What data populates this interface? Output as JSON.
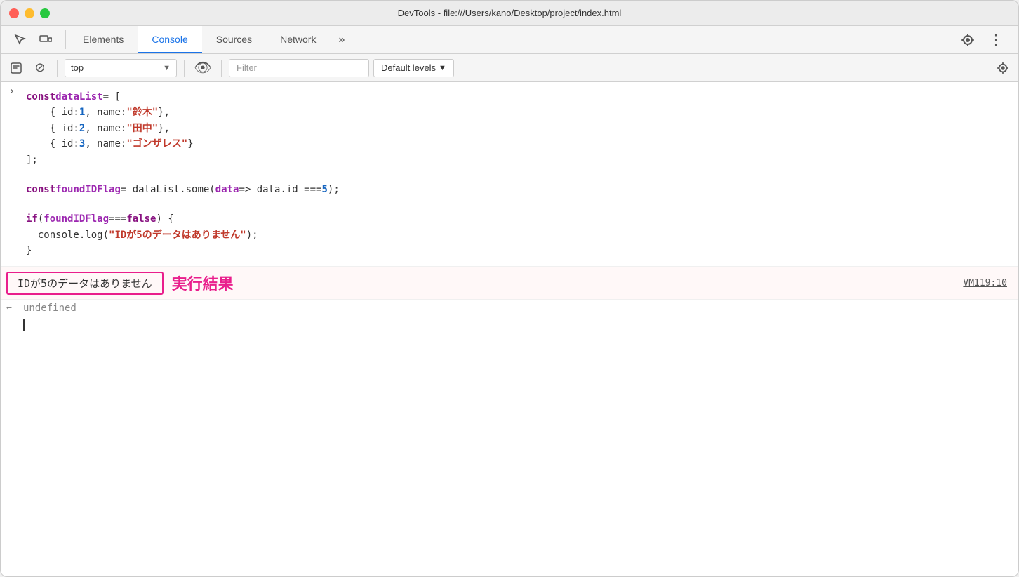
{
  "window": {
    "title": "DevTools - file:///Users/kano/Desktop/project/index.html"
  },
  "tabs": {
    "items": [
      {
        "id": "elements",
        "label": "Elements",
        "active": false
      },
      {
        "id": "console",
        "label": "Console",
        "active": true
      },
      {
        "id": "sources",
        "label": "Sources",
        "active": false
      },
      {
        "id": "network",
        "label": "Network",
        "active": false
      }
    ],
    "more_label": "»"
  },
  "toolbar": {
    "context_value": "top",
    "filter_placeholder": "Filter",
    "default_levels_label": "Default levels",
    "default_levels_arrow": "▼"
  },
  "code": {
    "line1": "const dataList = [",
    "line2_1": "{ id: ",
    "line2_num": "1",
    "line2_2": ", name: ",
    "line2_str": "\"鈴木\"",
    "line2_3": " },",
    "line3_1": "{ id: ",
    "line3_num": "2",
    "line3_2": ", name: ",
    "line3_str": "\"田中\"",
    "line3_3": " },",
    "line4_1": "{ id: ",
    "line4_num": "3",
    "line4_2": ", name: ",
    "line4_str": "\"ゴンザレス\"",
    "line4_3": " }",
    "line5": "];",
    "line6_1": "const foundIDFlag = dataList.some(data => data.id === ",
    "line6_num": "5",
    "line6_2": ");",
    "line7_1": "if (foundIDFlag === false) {",
    "line8": "  console.log(",
    "line8_str": "\"IDが5のデータはありません\"",
    "line8_end": ");",
    "line9": "}"
  },
  "output": {
    "box_text": "IDが5のデータはありません",
    "label_text": "実行結果",
    "location": "VM119:10"
  },
  "result": {
    "arrow": "←",
    "text": "undefined"
  }
}
